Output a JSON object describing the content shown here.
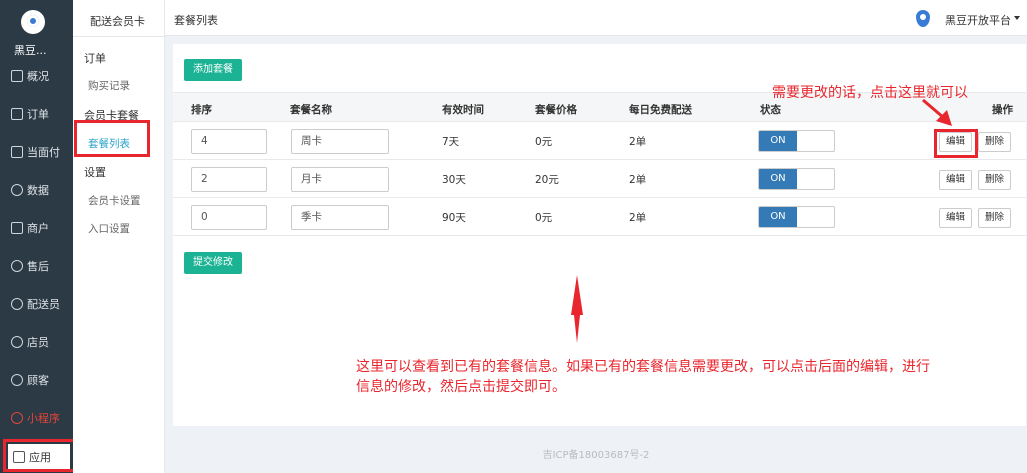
{
  "sidebar": {
    "brand": "黑豆...",
    "items": [
      {
        "label": "概况",
        "icon": "dashboard-icon"
      },
      {
        "label": "订单",
        "icon": "order-icon"
      },
      {
        "label": "当面付",
        "icon": "face-pay-icon"
      },
      {
        "label": "数据",
        "icon": "chart-icon"
      },
      {
        "label": "商户",
        "icon": "store-icon"
      },
      {
        "label": "售后",
        "icon": "after-sales-icon"
      },
      {
        "label": "配送员",
        "icon": "courier-icon"
      },
      {
        "label": "店员",
        "icon": "clerk-icon"
      },
      {
        "label": "顾客",
        "icon": "customer-icon"
      },
      {
        "label": "小程序",
        "icon": "miniprogram-icon"
      },
      {
        "label": "应用",
        "icon": "apps-icon"
      }
    ]
  },
  "subsidebar": {
    "title": "配送会员卡",
    "groups": [
      {
        "label": "订单",
        "links": [
          "购买记录"
        ]
      },
      {
        "label": "会员卡套餐",
        "links": [
          "套餐列表"
        ]
      },
      {
        "label": "设置",
        "links": [
          "会员卡设置",
          "入口设置"
        ]
      }
    ]
  },
  "topbar": {
    "title": "套餐列表",
    "platform": "黑豆开放平台"
  },
  "actions": {
    "add": "添加套餐",
    "submit": "提交修改"
  },
  "table": {
    "headers": [
      "排序",
      "套餐名称",
      "有效时间",
      "套餐价格",
      "每日免费配送",
      "状态",
      "操作"
    ],
    "rows": [
      {
        "sort": "4",
        "name": "周卡",
        "duration": "7天",
        "price": "0元",
        "daily": "2单",
        "status": "ON",
        "edit": "编辑",
        "delete": "删除"
      },
      {
        "sort": "2",
        "name": "月卡",
        "duration": "30天",
        "price": "20元",
        "daily": "2单",
        "status": "ON",
        "edit": "编辑",
        "delete": "删除"
      },
      {
        "sort": "0",
        "name": "季卡",
        "duration": "90天",
        "price": "0元",
        "daily": "2单",
        "status": "ON",
        "edit": "编辑",
        "delete": "删除"
      }
    ]
  },
  "annotations": {
    "edit_hint": "需要更改的话，点击这里就可以",
    "info_line1": "这里可以查看到已有的套餐信息。如果已有的套餐信息需要更改，可以点击后面的编辑，进行",
    "info_line2": "信息的修改，然后点击提交即可。"
  },
  "footer": "吉ICP备18003687号-2",
  "colors": {
    "sidebar_bg": "#2b3a45",
    "accent_green": "#1bb394",
    "toggle_blue": "#337ab7",
    "annotation_red": "#e8262d"
  }
}
